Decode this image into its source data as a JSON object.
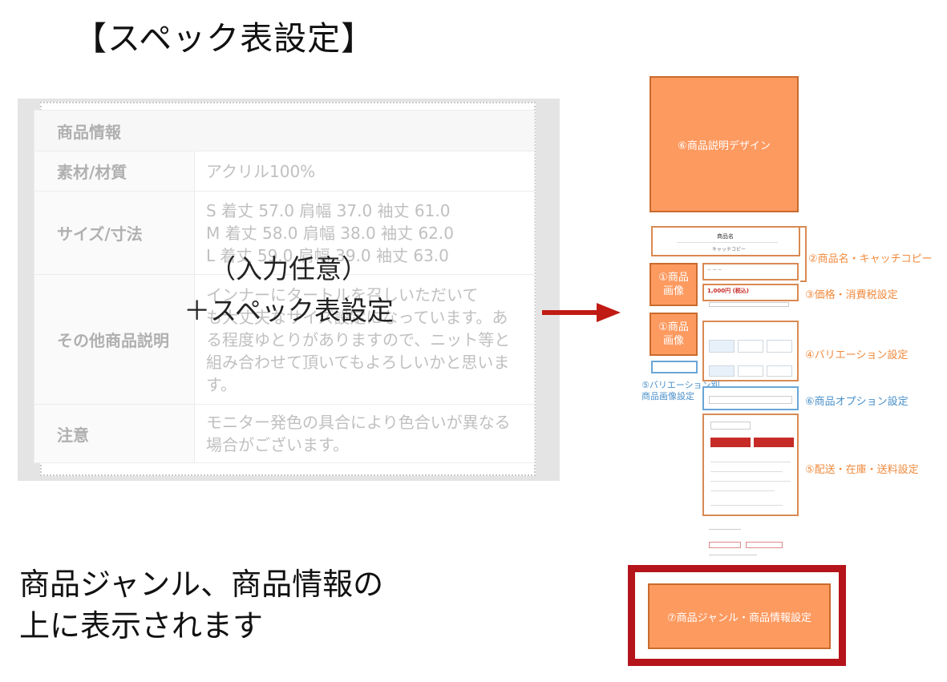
{
  "title": "【スペック表設定】",
  "spec_table": {
    "header": "商品情報",
    "rows": [
      {
        "key": "素材/材質",
        "value": "アクリル100%"
      },
      {
        "key": "サイズ/寸法",
        "lines": [
          "S 着丈 57.0 肩幅 37.0 袖丈 61.0",
          "M 着丈 58.0 肩幅 38.0 袖丈 62.0",
          "L 着丈 59.0 肩幅 39.0 袖丈 63.0"
        ]
      },
      {
        "key": "その他商品説明",
        "lines": [
          "インナーにタートルを召しいただいて",
          "も大丈夫なサイズ設定になっています。あ",
          "る程度ゆとりがありますので、ニット等と",
          "組み合わせて頂いてもよろしいかと思いま",
          "す。"
        ]
      },
      {
        "key": "注意",
        "lines": [
          "モニター発色の具合により色合いが異なる",
          "場合がございます。"
        ]
      }
    ]
  },
  "overlay": {
    "line1": "（入力任意）",
    "line2": "＋スペック表設定"
  },
  "statement": {
    "line1": "商品ジャンル、商品情報の",
    "line2": "上に表示されます"
  },
  "diagram": {
    "box6_label": "⑥商品説明デザイン",
    "product_name": "商品名",
    "catch_copy": "キャッチコピー",
    "label2": "②商品名・キャッチコピー",
    "image_box_a": [
      "①商品",
      "画像"
    ],
    "image_box_b": [
      "①商品",
      "画像"
    ],
    "label3": "③価格・消費税設定",
    "price_text": "1,000円 (税込)",
    "label4": "④バリエーション設定",
    "label5_variation_image": [
      "⑤バリエーション別",
      "商品画像設定"
    ],
    "label6_option": "⑥商品オプション設定",
    "label5_shipping": "⑤配送・在庫・送料設定",
    "box7_label": "⑦商品ジャンル・商品情報設定"
  },
  "colors": {
    "orange": "#fd9a60",
    "orange_label": "#f08a3d",
    "blue_label": "#4a90c9",
    "arrow_red": "#c01a14",
    "frame_red": "#b5141a"
  }
}
